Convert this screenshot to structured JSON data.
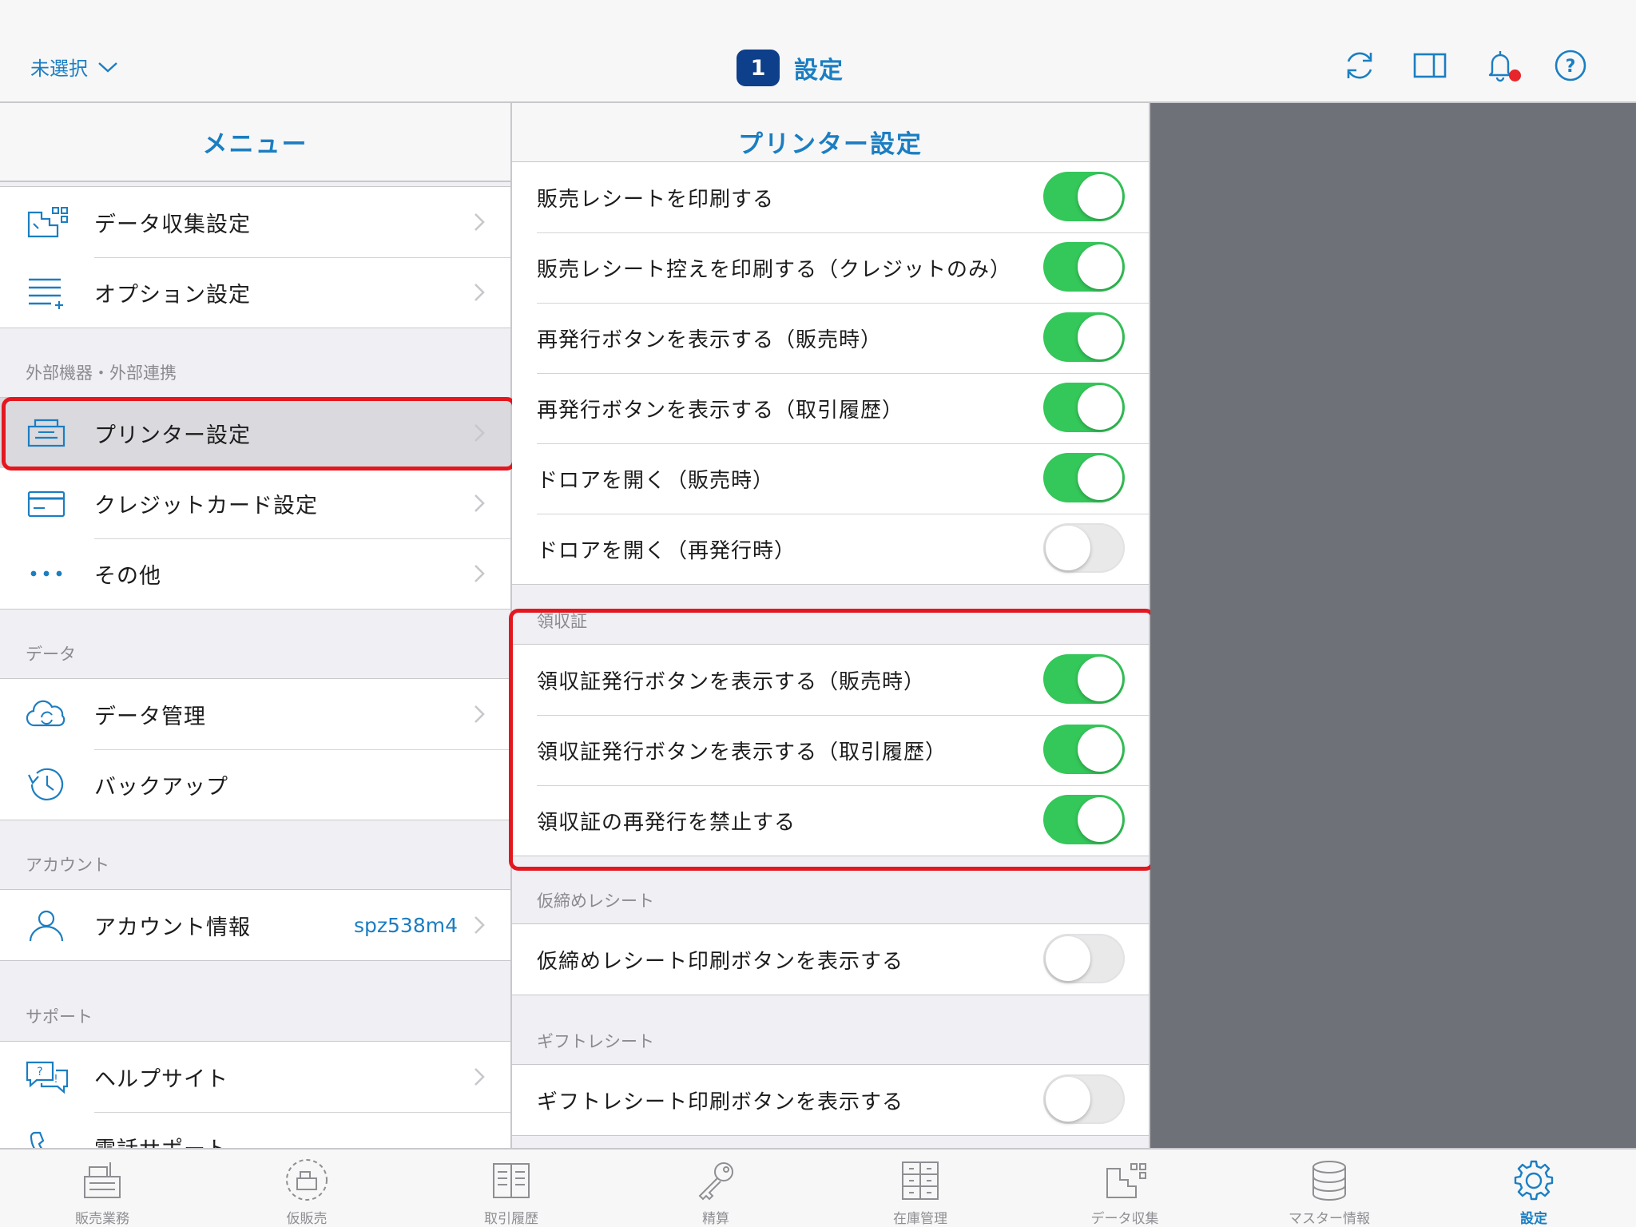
{
  "topbar": {
    "store_selector": "未選択",
    "title_badge": "1",
    "title": "設定",
    "icons": [
      "refresh-icon",
      "split-view-icon",
      "bell-icon",
      "help-icon"
    ]
  },
  "menu": {
    "header": "メニュー",
    "group1": [
      {
        "label": "データ収集設定",
        "icon": "data-collection-icon"
      },
      {
        "label": "オプション設定",
        "icon": "option-list-icon"
      }
    ],
    "section_external": "外部機器・外部連携",
    "group_external": [
      {
        "label": "プリンター設定",
        "icon": "printer-icon",
        "selected": true
      },
      {
        "label": "クレジットカード設定",
        "icon": "credit-card-icon"
      },
      {
        "label": "その他",
        "icon": "more-dots-icon"
      }
    ],
    "section_data": "データ",
    "group_data": [
      {
        "label": "データ管理",
        "icon": "cloud-sync-icon"
      },
      {
        "label": "バックアップ",
        "icon": "history-clock-icon"
      }
    ],
    "section_account": "アカウント",
    "account": {
      "label": "アカウント情報",
      "value": "spz538m4",
      "icon": "user-icon"
    },
    "section_support": "サポート",
    "group_support": [
      {
        "label": "ヘルプサイト",
        "icon": "help-chat-icon"
      },
      {
        "label": "電話サポート",
        "icon": "phone-icon",
        "value": "-"
      }
    ]
  },
  "printer": {
    "header": "プリンター設定",
    "receipt_rows": [
      {
        "label": "販売レシートを印刷する",
        "on": true
      },
      {
        "label": "販売レシート控えを印刷する（クレジットのみ）",
        "on": true
      },
      {
        "label": "再発行ボタンを表示する（販売時）",
        "on": true
      },
      {
        "label": "再発行ボタンを表示する（取引履歴）",
        "on": true
      },
      {
        "label": "ドロアを開く（販売時）",
        "on": true
      },
      {
        "label": "ドロアを開く（再発行時）",
        "on": false
      }
    ],
    "section_ryoshusho": "領収証",
    "ryoshusho_rows": [
      {
        "label": "領収証発行ボタンを表示する（販売時）",
        "on": true
      },
      {
        "label": "領収証発行ボタンを表示する（取引履歴）",
        "on": true
      },
      {
        "label": "領収証の再発行を禁止する",
        "on": true
      }
    ],
    "section_karishime": "仮締めレシート",
    "karishime_rows": [
      {
        "label": "仮締めレシート印刷ボタンを表示する",
        "on": false
      }
    ],
    "section_gift": "ギフトレシート",
    "gift_rows": [
      {
        "label": "ギフトレシート印刷ボタンを表示する",
        "on": false
      }
    ]
  },
  "tabbar": {
    "tabs": [
      {
        "label": "販売業務",
        "icon": "register-icon"
      },
      {
        "label": "仮販売",
        "icon": "provisional-sale-icon"
      },
      {
        "label": "取引履歴",
        "icon": "transaction-history-icon"
      },
      {
        "label": "精算",
        "icon": "key-icon"
      },
      {
        "label": "在庫管理",
        "icon": "inventory-cabinet-icon"
      },
      {
        "label": "データ収集",
        "icon": "data-collection-icon"
      },
      {
        "label": "マスター情報",
        "icon": "database-icon"
      },
      {
        "label": "設定",
        "icon": "gear-icon",
        "active": true
      }
    ]
  },
  "colors": {
    "accent": "#1b7ec2",
    "toggle_on": "#34c759",
    "highlight": "#e4171f",
    "badge": "#0d3f8a",
    "detail_bg": "#6f7178"
  }
}
